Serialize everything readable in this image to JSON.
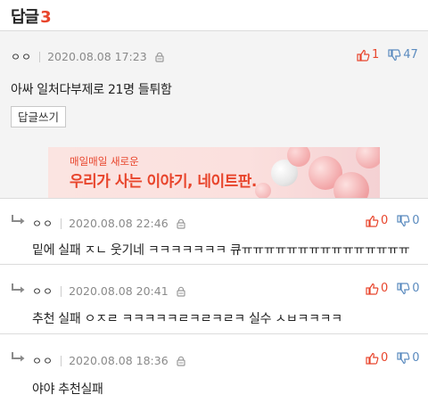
{
  "header": {
    "title": "답글",
    "count": "3"
  },
  "main_comment": {
    "author": "ㅇㅇ",
    "date": "2020.08.08 17:23",
    "up": "1",
    "down": "47",
    "text": "아싸 일처다부제로 21명 들튀함",
    "reply_button": "답글쓰기"
  },
  "banner": {
    "top_text": "매일매일 새로운",
    "main_text": "우리가 사는 이야기, 네이트판."
  },
  "replies": [
    {
      "author": "ㅇㅇ",
      "date": "2020.08.08 22:46",
      "up": "0",
      "down": "0",
      "text": "밑에 실패 ㅈㄴ 웃기네 ㅋㅋㅋㅋㅋㅋㅋ 큐ㅠㅠㅠㅠㅠㅠㅠㅠㅠㅠㅠㅠㅠㅠㅠ"
    },
    {
      "author": "ㅇㅇ",
      "date": "2020.08.08 20:41",
      "up": "0",
      "down": "0",
      "text": "추천 실패 ㅇㅈㄹ ㅋㅋㅋㅋㅋㄹㅋㄹㅋㄹㅋ 실수 ㅅㅂㅋㅋㅋㅋ"
    },
    {
      "author": "ㅇㅇ",
      "date": "2020.08.08 18:36",
      "up": "0",
      "down": "0",
      "text": "야야 추천실패"
    }
  ],
  "colors": {
    "accent": "#e8452c",
    "down_vote": "#5b8bbf"
  },
  "icons": {
    "lock": "lock-icon",
    "thumbs_up": "thumbs-up-icon",
    "thumbs_down": "thumbs-down-icon",
    "reply_arrow": "reply-arrow-icon"
  }
}
